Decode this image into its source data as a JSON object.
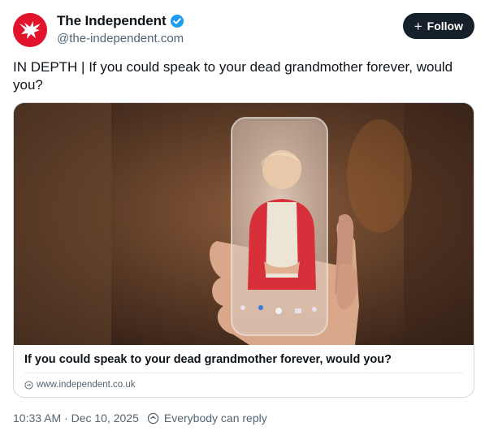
{
  "account": {
    "display_name": "The Independent",
    "handle": "@the-independent.com",
    "verified": true,
    "avatar_icon": "eagle-logo-icon",
    "avatar_color": "#e1142b"
  },
  "follow_button": {
    "label": "Follow",
    "icon": "plus-icon"
  },
  "post": {
    "text": "IN DEPTH | If you could speak to your dead grandmother forever, would you?"
  },
  "link_card": {
    "image_icon": "grandmother-in-phone-image",
    "title": "If you could speak to your dead grandmother forever, would you?",
    "source": "www.independent.co.uk",
    "source_icon": "link-globe-icon"
  },
  "footer": {
    "timestamp": "10:33 AM · Dec 10, 2025",
    "reply_setting": "Everybody can reply",
    "reply_icon": "reply-setting-icon"
  },
  "colors": {
    "accent_blue": "#1d9bf0",
    "follow_bg": "#16202a",
    "text_secondary": "#536471"
  }
}
